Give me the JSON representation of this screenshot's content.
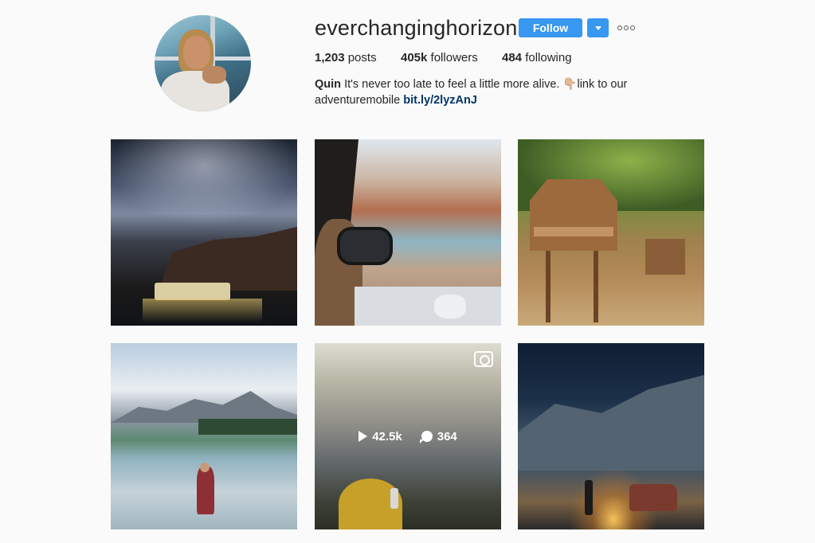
{
  "profile": {
    "username": "everchanginghorizon",
    "follow_label": "Follow",
    "stats": {
      "posts_count": "1,203",
      "posts_label": "posts",
      "followers_count": "405k",
      "followers_label": "followers",
      "following_count": "484",
      "following_label": "following"
    },
    "bio": {
      "name": "Quin",
      "text": "It's never too late to feel a little more alive. 👇🏼link to our adventuremobile",
      "link": "bit.ly/2lyzAnJ"
    }
  },
  "icons": {
    "dropdown": "chevron-down-icon",
    "more": "more-options-icon",
    "video": "video-icon",
    "play": "play-icon",
    "comment": "comment-icon"
  },
  "colors": {
    "accent": "#3897f0",
    "link": "#003569",
    "text": "#262626",
    "background": "#fafafa"
  },
  "posts": [
    {
      "type": "photo"
    },
    {
      "type": "photo"
    },
    {
      "type": "photo"
    },
    {
      "type": "photo"
    },
    {
      "type": "video",
      "views": "42.5k",
      "comments": "364"
    },
    {
      "type": "photo"
    }
  ]
}
